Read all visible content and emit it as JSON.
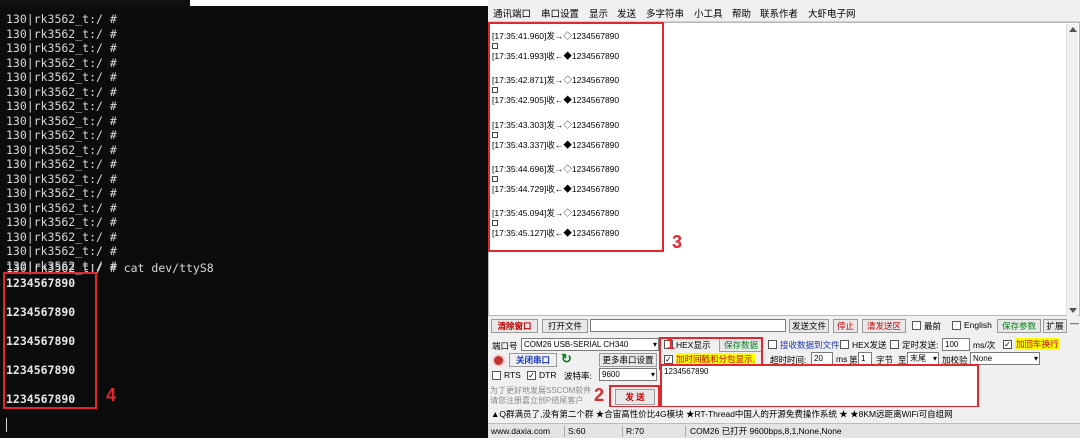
{
  "terminal": {
    "prompt_lines": [
      "130|rk3562_t:/ #",
      "130|rk3562_t:/ #",
      "130|rk3562_t:/ #",
      "130|rk3562_t:/ #",
      "130|rk3562_t:/ #",
      "130|rk3562_t:/ #",
      "130|rk3562_t:/ #",
      "130|rk3562_t:/ #",
      "130|rk3562_t:/ #",
      "130|rk3562_t:/ #",
      "130|rk3562_t:/ #",
      "130|rk3562_t:/ #",
      "130|rk3562_t:/ #",
      "130|rk3562_t:/ #",
      "130|rk3562_t:/ #",
      "130|rk3562_t:/ #",
      "130|rk3562_t:/ #",
      "130|rk3562_t:/ #"
    ],
    "command_line": "130|rk3562_t:/ # cat dev/ttyS8",
    "outputs": [
      "1234567890",
      "1234567890",
      "1234567890",
      "1234567890",
      "1234567890"
    ],
    "annotation": "4"
  },
  "tool": {
    "menu": [
      "通讯端口",
      "串口设置",
      "显示",
      "发送",
      "多字符串",
      "小工具",
      "帮助",
      "联系作者",
      "大虾电子网"
    ],
    "log": [
      {
        "sent": "[17:35:41.960]发→◇1234567890",
        "recv": "[17:35:41.993]收←◆1234567890"
      },
      {
        "sent": "[17:35:42.871]发→◇1234567890",
        "recv": "[17:35:42.905]收←◆1234567890"
      },
      {
        "sent": "[17:35:43.303]发→◇1234567890",
        "recv": "[17:35:43.337]收←◆1234567890"
      },
      {
        "sent": "[17:35:44.696]发→◇1234567890",
        "recv": "[17:35:44.729]收←◆1234567890"
      },
      {
        "sent": "[17:35:45.094]发→◇1234567890",
        "recv": "[17:35:45.127]收←◆1234567890"
      }
    ],
    "annotations": {
      "log": "3",
      "port": "1",
      "send": "2"
    },
    "row1": {
      "clear_window": "清除窗口",
      "open_file": "打开文件",
      "send_file": "发送文件",
      "stop": "停止",
      "clear_send": "清发送区",
      "topmost": "最前",
      "english": "English",
      "save_params": "保存参数",
      "expand": "扩展"
    },
    "row2": {
      "port_label": "端口号",
      "port_value": "COM26 USB-SERIAL CH340",
      "hex_display": "HEX显示",
      "save_data": "保存数据",
      "recv_to_file": "接收数据到文件",
      "hex_send": "HEX发送",
      "timed_send": "定时发送:",
      "interval": "100",
      "interval_unit": "ms/次",
      "append_newline": "加回车换行"
    },
    "row3": {
      "close_port": "关闭串口",
      "more_settings": "更多串口设置",
      "timestamp": "加时间戳和分包显示,",
      "timeout_label": "超时时间:",
      "timeout_value": "20",
      "timeout_unit": "ms",
      "nth_label": "第",
      "nth_value": "1",
      "byte_label": "字节",
      "to_label": "至",
      "to_value": "末尾",
      "checksum_label": "加校验",
      "checksum_value": "None"
    },
    "row4": {
      "rts": "RTS",
      "dtr": "DTR",
      "baud_label": "波特率:",
      "baud_value": "9600"
    },
    "promo": [
      "为了更好地发展SSCOM软件",
      "请您注册嘉立创P结尾客户"
    ],
    "send_button": "发 送",
    "send_text": "1234567890",
    "ad": "▲Q群满员了,没有第二个群  ★合宙高性价比4G模块  ★RT-Thread中国人的开源免费操作系统  ★  ★8KM远距离WiFi可自组网",
    "status": {
      "site": "www.daxia.com",
      "s": "S:60",
      "r": "R:70",
      "port_status": "COM26 已打开  9600bps,8,1,None,None"
    }
  }
}
